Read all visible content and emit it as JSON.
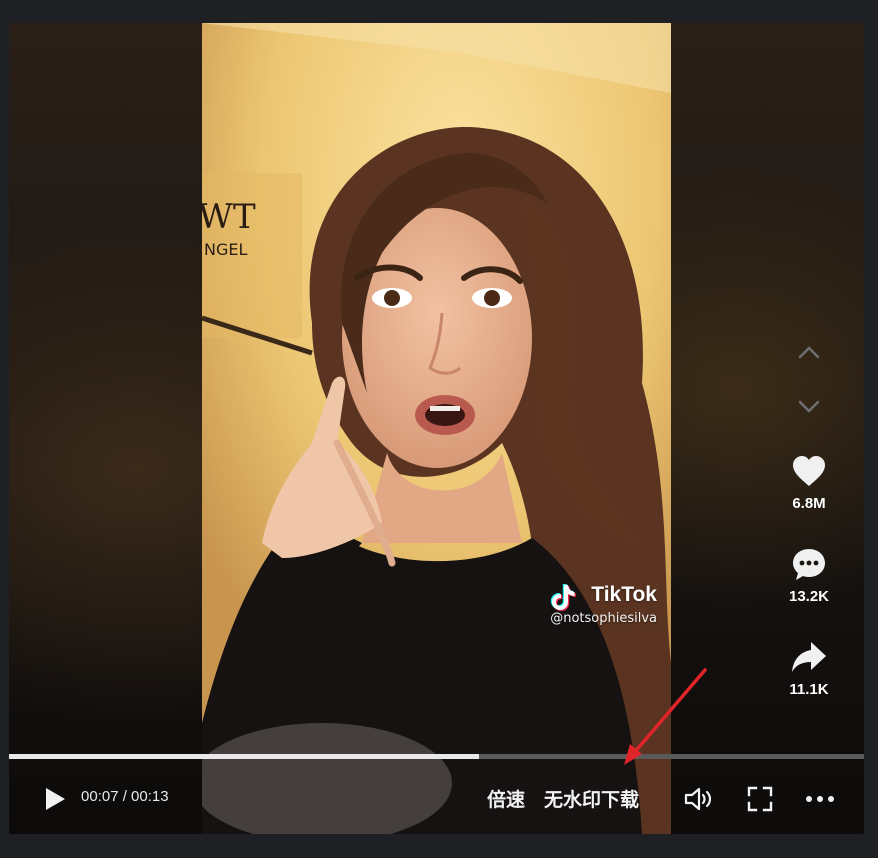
{
  "video": {
    "brand": "TikTok",
    "handle": "@notsophiesilva",
    "wall_text_top": "WT",
    "wall_text_bottom": "NGEL"
  },
  "sidebar": {
    "likes": "6.8M",
    "comments": "13.2K",
    "shares": "11.1K"
  },
  "player": {
    "time": "00:07 / 00:13",
    "progress": 0.55,
    "speed_label": "倍速",
    "download_label": "无水印下载"
  },
  "icons": {
    "prev": "chevron-up-icon",
    "next": "chevron-down-icon",
    "like": "heart-icon",
    "comment": "comment-icon",
    "share": "share-icon",
    "play": "play-icon",
    "volume": "volume-icon",
    "fullscreen": "fullscreen-icon",
    "more": "more-icon"
  },
  "colors": {
    "annotation_arrow": "#e0242a",
    "page_bg": "#1e2024"
  }
}
